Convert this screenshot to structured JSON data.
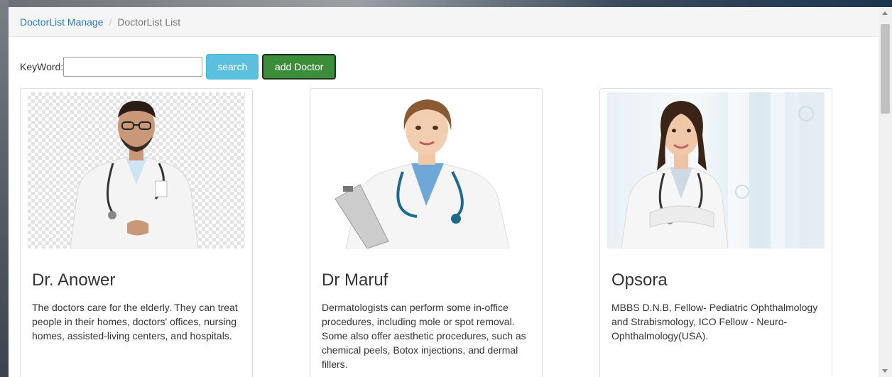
{
  "breadcrumb": {
    "parent": "DoctorList Manage",
    "separator": "/",
    "current": "DoctorList List"
  },
  "toolbar": {
    "keyword_label": "KeyWord:",
    "keyword_value": "",
    "search_label": "search",
    "add_label": "add Doctor"
  },
  "doctors": [
    {
      "name": "Dr. Anower",
      "description": "The doctors care for the elderly. They can treat people in their homes, doctors' offices, nursing homes, assisted-living centers, and hospitals."
    },
    {
      "name": "Dr Maruf",
      "description": "Dermatologists can perform some in-office procedures, including mole or spot removal. Some also offer aesthetic procedures, such as chemical peels, Botox injections, and dermal fillers."
    },
    {
      "name": "Opsora",
      "description": "MBBS D.N.B, Fellow- Pediatric Ophthalmology and Strabismology, ICO Fellow - Neuro-Ophthalmology(USA)."
    }
  ],
  "colors": {
    "link": "#337ab7",
    "search_button": "#5bc0de",
    "add_button": "#3c8d3a"
  }
}
